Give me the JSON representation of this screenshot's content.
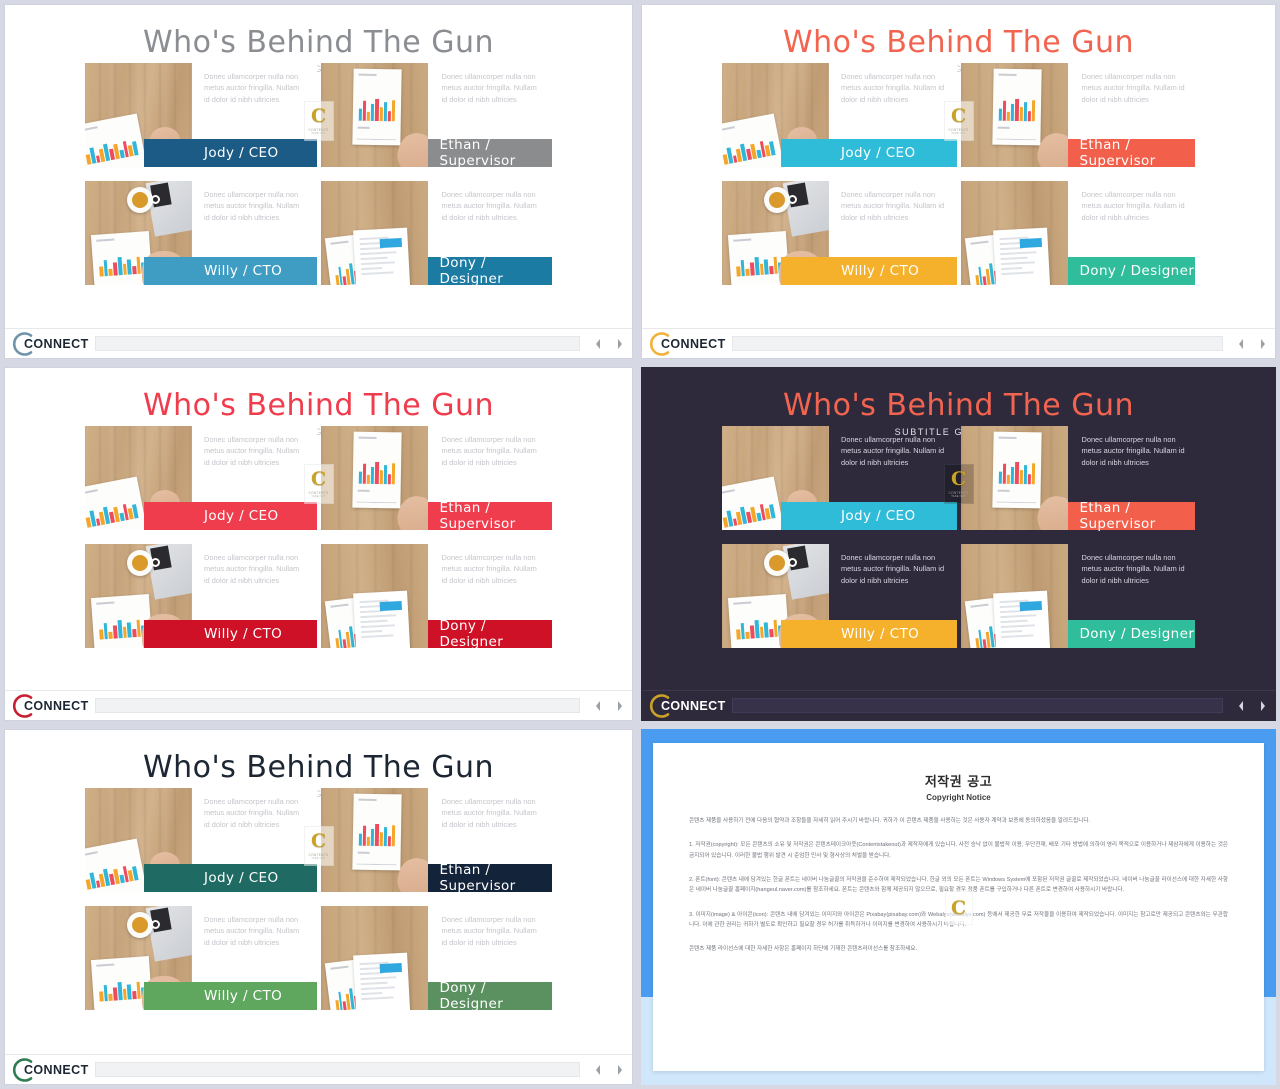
{
  "slide": {
    "title": "Who's Behind The Gun",
    "subtitle": "SUBTITLE GOES HERE",
    "body_text": "Donec ullamcorper nulla non metus auctor fringilla. Nullam id dolor id nibh ultricies",
    "members": [
      {
        "name": "Jody / CEO"
      },
      {
        "name": "Ethan / Supervisor"
      },
      {
        "name": "Willy / CTO"
      },
      {
        "name": "Dony / Designer"
      }
    ],
    "watermark": {
      "letter": "C",
      "line1": "CONTENTS",
      "line2": "TAKE  OUT"
    }
  },
  "footer": {
    "brand": "CONNECT",
    "prev_label": "◀",
    "next_label": "▶"
  },
  "variants": [
    {
      "id": "variant-blue-gray",
      "title_color": "#8a8d92",
      "subtitle_color": "#c2c4c9",
      "background": "#ffffff",
      "name_colors": [
        "#1c5b86",
        "#8a8c8e",
        "#3f9dc4",
        "#1c7ba3"
      ],
      "brand_arc_color": "#6f93ab"
    },
    {
      "id": "variant-coral-multi",
      "title_color": "#f2644f",
      "subtitle_color": "#c9cbd0",
      "background": "#ffffff",
      "name_colors": [
        "#2fbcd8",
        "#f2604b",
        "#f6b12c",
        "#2fbd9b"
      ],
      "brand_arc_color": "#f2b23a"
    },
    {
      "id": "variant-red",
      "title_color": "#ef3d4e",
      "subtitle_color": "#c9cbd0",
      "background": "#ffffff",
      "name_colors": [
        "#ef3d4e",
        "#ef3d4e",
        "#cf1127",
        "#cf1127"
      ],
      "brand_arc_color": "#c81f33"
    },
    {
      "id": "variant-dark",
      "title_color": "#f2644f",
      "subtitle_color": "#e2e0ea",
      "background": "#2e2a3c",
      "name_colors": [
        "#2fbcd8",
        "#f2604b",
        "#f6b12c",
        "#2fbd9b"
      ],
      "brand_arc_color": "#c9a227"
    },
    {
      "id": "variant-green",
      "title_color": "#1d2733",
      "subtitle_color": "#c9cbd0",
      "background": "#ffffff",
      "name_colors": [
        "#1f6b63",
        "#12233a",
        "#5fa75e",
        "#5b9160"
      ],
      "brand_arc_color": "#2f7d52"
    }
  ],
  "copyright": {
    "title": "저작권 공고",
    "subtitle": "Copyright Notice",
    "intro": "콘텐츠 제품을 사용하기 전에 다음의 협약과 조항들을 자세히 읽어 주시기 바랍니다. 귀하가 이 콘텐츠 제품을 사용하는 것은 사용자 계약과 보증에 동의하셨음을 알려드립니다.",
    "section1": "1. 저작권(copyright): 모든 콘텐츠의 소유 및 저작권은 콘텐츠테이크아웃(Contentstakeout)과 제작자에게 있습니다. 사전 승낙 없이 불법적 이용, 무단전재, 배포 기타 방법에 의하여 영리 목적으로 이용하거나 제삼자에게 이용하는 것은 금지되어 있습니다. 이러한 불법 행위 발견 시 준엄한 민사 및 형사상의 처벌을 받습니다.",
    "section2": "2. 폰트(font): 콘텐츠 내에 담겨있는 한글 폰트는 네이버 나눔글꼴의 저작권을 준수하여 제작되었습니다. 한글 외의 모든 폰트는 Windows System에 포함된 저작권 글꼴로 제작되었습니다. 네이버 나눔글꼴 라이선스에 대한 자세한 사항은 네이버 나눔글꼴 홈페이지(hangeul.naver.com)를 참조하세요. 폰트는 콘텐츠와 함께 제공되지 않으므로, 필요할 경우 정품 폰트를 구입하거나 다른 폰트로 변경하여 사용하시기 바랍니다.",
    "section3": "3. 이미지(image) & 아이콘(icon): 콘텐츠 내에 담겨있는 이미지와 아이콘은 Pixabay(pixabay.com)와 Webalys(webalys.com) 등에서 제공한 무료 저작물을 이용하여 제작되었습니다. 이미지는 참고로만 제공되고 콘텐츠와는 무관합니다. 이에 관한 권리는 귀하가 별도로 확인하고 필요할 경우 허가를 취득하거나 이미지를 변경하여 사용하시기 바랍니다.",
    "closing": "콘텐츠 제품 라이선스에 대한 자세한 사항은 홈페이지 하단에 기재한 콘텐츠라이선스를 참조하세요.",
    "border_color": "#4a9cf0"
  }
}
